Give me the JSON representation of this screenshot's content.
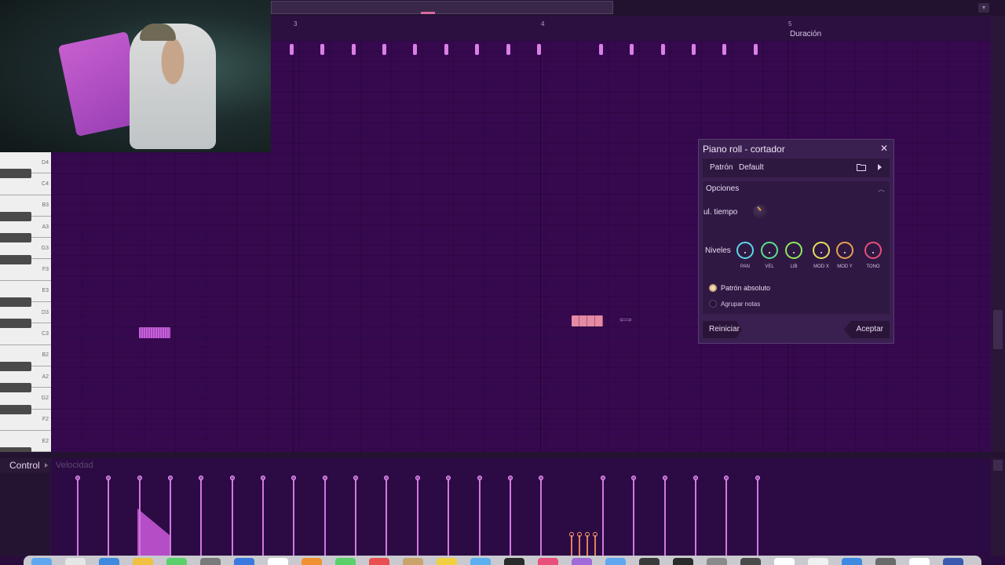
{
  "ruler": {
    "markers": [
      "3",
      "4",
      "5"
    ],
    "duration_label": "Duración"
  },
  "piano": {
    "key_labels": [
      "D4",
      "C4",
      "B3",
      "A3",
      "G3",
      "F3",
      "E3",
      "D3",
      "C3",
      "B2",
      "A2",
      "G2",
      "F2",
      "E2"
    ]
  },
  "dialog": {
    "title": "Piano roll - cortador",
    "close_icon": "close-icon",
    "pattern_label": "Patrón",
    "pattern_value": "Default",
    "folder_icon": "folder-icon",
    "next_icon": "play-arrow-icon",
    "options_title": "Opciones",
    "time_label": "ul. tiempo",
    "levels_label": "Niveles",
    "knobs": [
      {
        "label": "PAN",
        "color": "#5ed6e6"
      },
      {
        "label": "VEL",
        "color": "#5be08a"
      },
      {
        "label": "LIB",
        "color": "#8fe85a"
      },
      {
        "label": "MOD X",
        "color": "#e6df5a"
      },
      {
        "label": "MOD Y",
        "color": "#e6a14f"
      },
      {
        "label": "TONO",
        "color": "#e84f7a"
      }
    ],
    "radio_absolute": "Patrón absoluto",
    "radio_absolute_selected": true,
    "radio_group": "Agrupar notas",
    "radio_group_selected": false,
    "reset_label": "Reiniciar",
    "accept_label": "Aceptar"
  },
  "control": {
    "label": "Control",
    "parameter": "Velocidad"
  },
  "colors": {
    "accent": "#d97fe6",
    "grid": "#36094f",
    "dialog_bg": "#3a2050"
  }
}
